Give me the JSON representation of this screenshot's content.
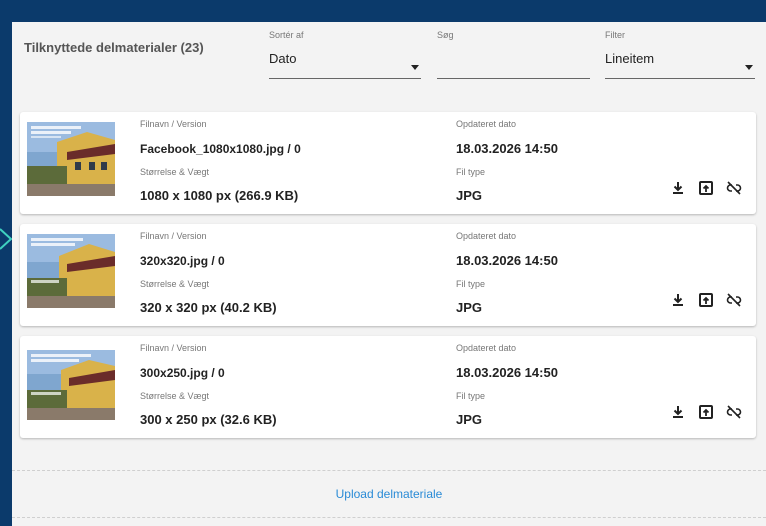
{
  "header": {
    "title": "Tilknyttede delmaterialer (23)",
    "sort": {
      "label": "Sortér af",
      "value": "Dato"
    },
    "search": {
      "label": "Søg",
      "value": ""
    },
    "filter": {
      "label": "Filter",
      "value": "Lineitem"
    }
  },
  "labels": {
    "filename": "Filnavn / Version",
    "size": "Størrelse & Vægt",
    "updated": "Opdateret dato",
    "filetype": "Fil type"
  },
  "items": [
    {
      "filename": "Facebook_1080x1080.jpg / 0",
      "size": "1080 x 1080 px (266.9 KB)",
      "updated": "18.03.2026 14:50",
      "filetype": "JPG"
    },
    {
      "filename": "320x320.jpg / 0",
      "size": "320 x 320 px (40.2 KB)",
      "updated": "18.03.2026 14:50",
      "filetype": "JPG"
    },
    {
      "filename": "300x250.jpg / 0",
      "size": "300 x 250 px (32.6 KB)",
      "updated": "18.03.2026 14:50",
      "filetype": "JPG"
    }
  ],
  "icons": {
    "download": "download-icon",
    "open": "open-in-new-icon",
    "unlink": "unlink-icon"
  },
  "upload_label": "Upload delmateriale",
  "colors": {
    "page_bg": "#0b3a6b",
    "panel_bg": "#f3f3f3",
    "link": "#2a8bd6"
  }
}
